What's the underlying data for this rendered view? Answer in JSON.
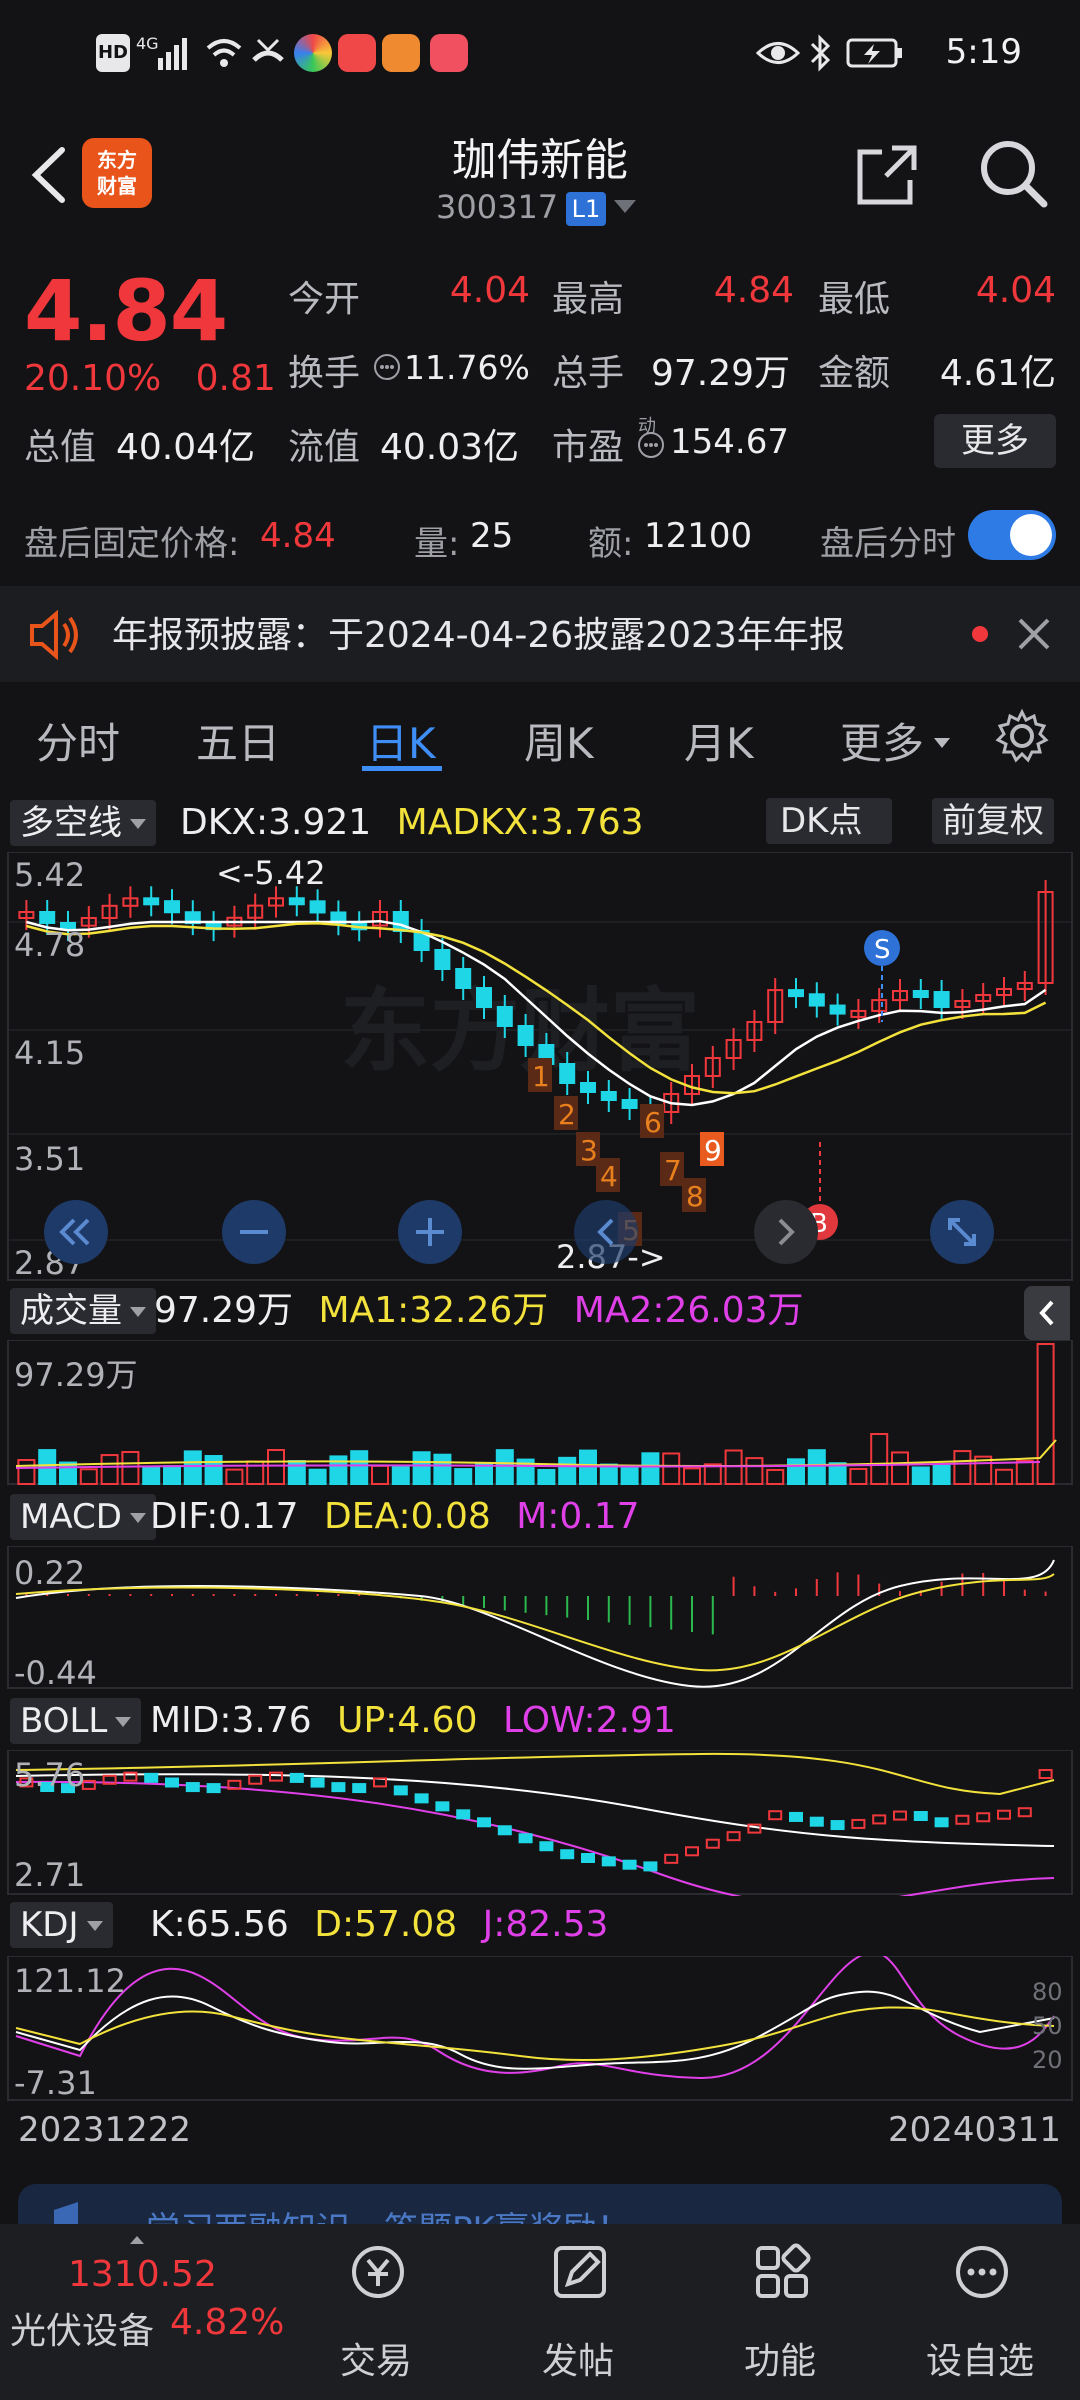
{
  "status_bar": {
    "time": "5:19",
    "network": "4G"
  },
  "header": {
    "logo": "东方\n财富",
    "stock_name": "珈伟新能",
    "stock_code": "300317",
    "level_badge": "L1"
  },
  "quote": {
    "price": "4.84",
    "change_pct": "20.10%",
    "change_amt": "0.81",
    "open_label": "今开",
    "open": "4.04",
    "high_label": "最高",
    "high": "4.84",
    "low_label": "最低",
    "low": "4.04",
    "turnover_label": "换手",
    "turnover": "11.76%",
    "volume_label": "总手",
    "volume": "97.29万",
    "amount_label": "金额",
    "amount": "4.61亿",
    "mktcap_label": "总值",
    "mktcap": "40.04亿",
    "float_label": "流值",
    "float_cap": "40.03亿",
    "pe_label": "市盈",
    "pe_sup": "动",
    "pe": "154.67",
    "more_label": "更多"
  },
  "after_hours": {
    "price_label": "盘后固定价格:",
    "price": "4.84",
    "vol_label": "量:",
    "vol": "25",
    "amt_label": "额:",
    "amt": "12100",
    "toggle_label": "盘后分时",
    "toggle_on": true
  },
  "notice": {
    "text": "年报预披露：于2024-04-26披露2023年年报"
  },
  "tabs": [
    "分时",
    "五日",
    "日K",
    "周K",
    "月K",
    "更多"
  ],
  "active_tab": "日K",
  "main_indicator": {
    "name": "多空线",
    "dkx_label": "DKX:3.921",
    "madkx_label": "MADKX:3.763",
    "dk_btn": "DK点",
    "adjust_btn": "前复权",
    "y_labels": [
      "5.42",
      "4.78",
      "4.15",
      "3.51",
      "2.87"
    ],
    "high_marker": "<-5.42",
    "low_marker": "2.87->",
    "sell_mark": "S",
    "buy_mark": "B",
    "watermark": "东方财富",
    "count_marks": [
      "1",
      "2",
      "3",
      "4",
      "5",
      "6",
      "7",
      "8",
      "9"
    ]
  },
  "volume_indicator": {
    "name": "成交量",
    "vol": "97.29万",
    "ma1": "MA1:32.26万",
    "ma2": "MA2:26.03万",
    "y_max": "97.29万"
  },
  "macd": {
    "name": "MACD",
    "dif": "DIF:0.17",
    "dea": "DEA:0.08",
    "m": "M:0.17",
    "y_top": "0.22",
    "y_bottom": "-0.44"
  },
  "boll": {
    "name": "BOLL",
    "mid": "MID:3.76",
    "up": "UP:4.60",
    "low": "LOW:2.91",
    "y_top": "5.76",
    "y_bottom": "2.71"
  },
  "kdj": {
    "name": "KDJ",
    "k": "K:65.56",
    "d": "D:57.08",
    "j": "J:82.53",
    "y_top": "121.12",
    "y_bottom": "-7.31",
    "levels": [
      "80",
      "50",
      "20"
    ]
  },
  "date_range": {
    "start": "20231222",
    "end": "20240311"
  },
  "banner": {
    "text": "学习两融知识，答题PK赢奖励！"
  },
  "bottom_nav": {
    "index_value": "1310.52",
    "index_name": "光伏设备",
    "index_change": "4.82%",
    "items": [
      "交易",
      "发帖",
      "功能",
      "设自选"
    ]
  },
  "colors": {
    "up": "#f0383c",
    "down": "#1fd6e6",
    "accent": "#3e8ef6",
    "dkx": "#ffffff",
    "madkx": "#f3e23c"
  }
}
